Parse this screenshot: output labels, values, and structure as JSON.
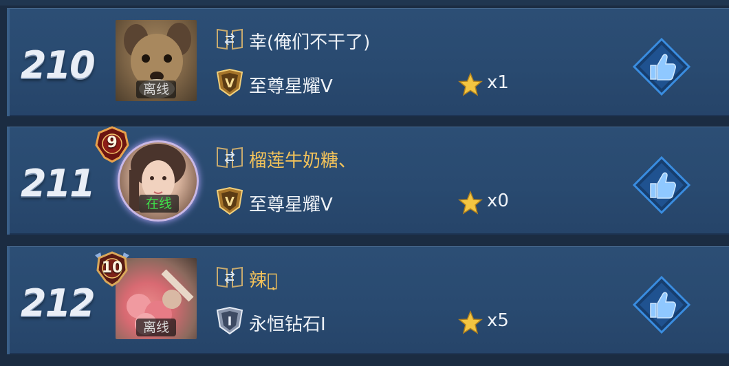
{
  "players": [
    {
      "rank": "210",
      "name": "幸(俺们不干了)",
      "name_color": "white",
      "status": "离线",
      "tier": "至尊星耀V",
      "tier_icon": "star-glory-badge",
      "stars": "x1"
    },
    {
      "rank": "211",
      "name": "榴莲牛奶糖、",
      "name_color": "gold",
      "status": "在线",
      "level": "9",
      "tier": "至尊星耀V",
      "tier_icon": "star-glory-badge",
      "stars": "x0"
    },
    {
      "rank": "212",
      "name": "辣妹ͅ",
      "name_color": "gold",
      "status": "离线",
      "level": "10",
      "tier": "永恒钻石I",
      "tier_icon": "eternal-diamond-badge",
      "stars": "x5"
    }
  ],
  "colors": {
    "row_bg": "#2b4c73",
    "gold_name": "#f2c25a",
    "online": "#3ee04a",
    "like_blue": "#2f8fe0"
  }
}
